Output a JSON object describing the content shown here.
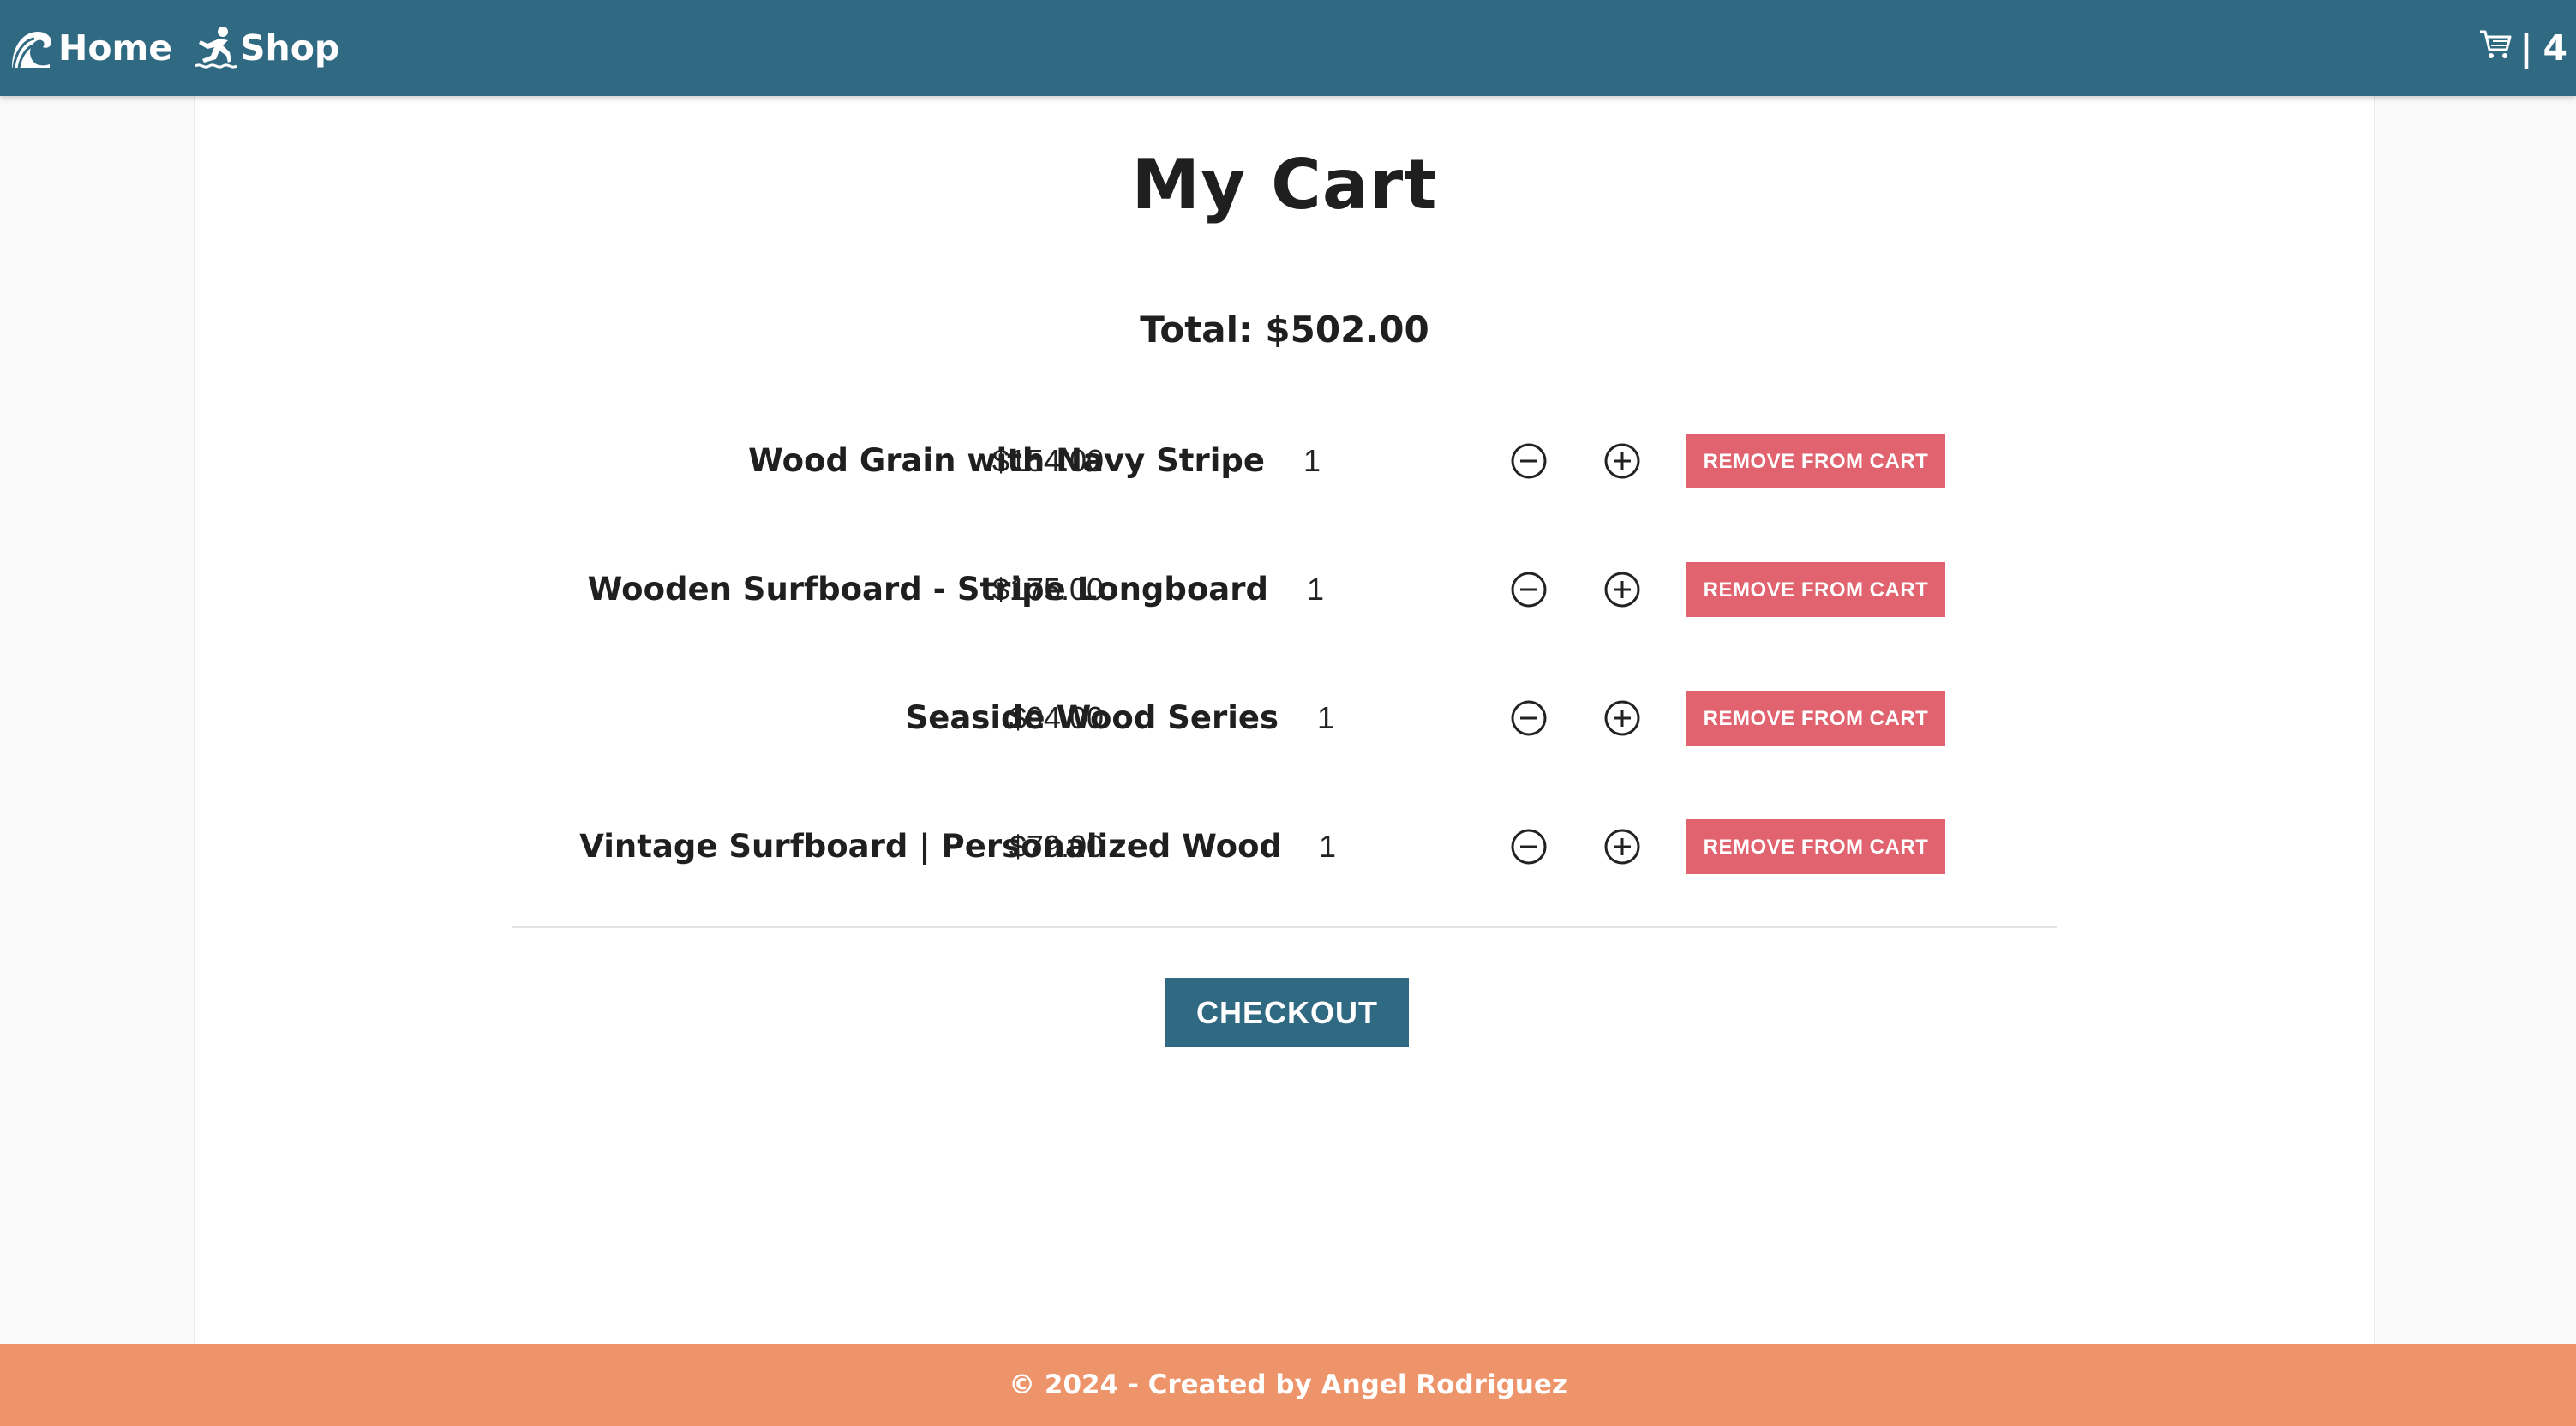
{
  "nav": {
    "home_label": "Home",
    "home_icon": "wave-icon",
    "shop_label": "Shop",
    "shop_icon": "surfer-icon",
    "cart_icon": "cart-icon",
    "cart_separator": "|",
    "cart_count": "4"
  },
  "cart": {
    "title": "My Cart",
    "total_label": "Total: $502.00",
    "items": [
      {
        "name": "Wood Grain with Navy Stripe",
        "quantity": "1",
        "price": "$154.00",
        "remove_label": "REMOVE FROM CART"
      },
      {
        "name": "Wooden Surfboard - Stripe Longboard",
        "quantity": "1",
        "price": "$175.00",
        "remove_label": "REMOVE FROM CART"
      },
      {
        "name": "Seaside Wood Series",
        "quantity": "1",
        "price": "$94.00",
        "remove_label": "REMOVE FROM CART"
      },
      {
        "name": "Vintage Surfboard | Personalized Wood",
        "quantity": "1",
        "price": "$79.00",
        "remove_label": "REMOVE FROM CART"
      }
    ],
    "checkout_label": "CHECKOUT"
  },
  "footer": {
    "text": "© 2024 - Created by Angel Rodriguez"
  },
  "colors": {
    "navbar": "#306982",
    "remove_button": "#e0636f",
    "checkout_button": "#306982",
    "footer": "#ee946b"
  }
}
